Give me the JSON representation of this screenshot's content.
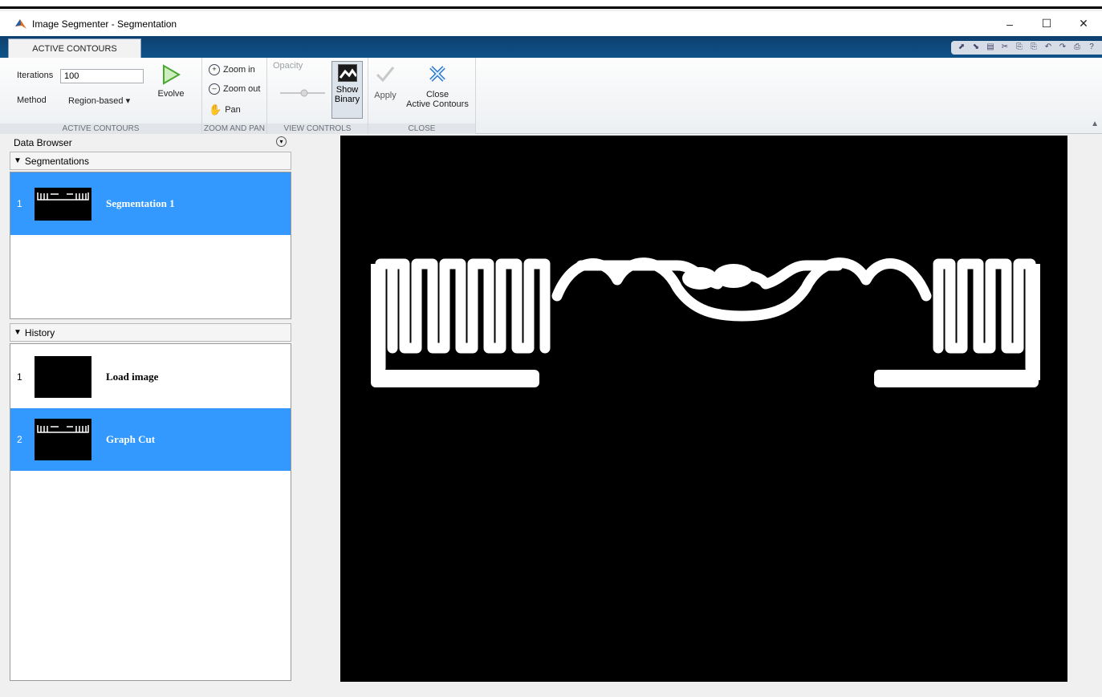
{
  "window": {
    "title": "Image Segmenter - Segmentation",
    "controls": [
      "–",
      "☐",
      "✕"
    ]
  },
  "tab": {
    "label": "ACTIVE CONTOURS"
  },
  "quick_access": [
    "⬈",
    "⬊",
    "▤",
    "✂",
    "⎘",
    "⎘",
    "↶",
    "↷",
    "⎙",
    "?"
  ],
  "ribbon": {
    "active_contours": {
      "iterations_label": "Iterations",
      "iterations_value": "100",
      "method_label": "Method",
      "method_value": "Region-based",
      "evolve_label": "Evolve",
      "section_label": "ACTIVE CONTOURS"
    },
    "zoom_pan": {
      "zoom_in_label": "Zoom in",
      "zoom_out_label": "Zoom out",
      "pan_label": "Pan",
      "section_label": "ZOOM AND PAN"
    },
    "view_controls": {
      "opacity_label": "Opacity",
      "show_binary_line1": "Show",
      "show_binary_line2": "Binary",
      "section_label": "VIEW CONTROLS"
    },
    "close": {
      "apply_label": "Apply",
      "close_line1": "Close",
      "close_line2": "Active Contours",
      "section_label": "CLOSE"
    }
  },
  "data_browser": {
    "title": "Data Browser",
    "segmentations": {
      "header": "Segmentations",
      "items": [
        {
          "num": "1",
          "label": "Segmentation 1"
        }
      ]
    },
    "history": {
      "header": "History",
      "items": [
        {
          "num": "1",
          "label": "Load image"
        },
        {
          "num": "2",
          "label": "Graph Cut"
        }
      ]
    }
  },
  "colors": {
    "selection": "#3399ff",
    "tabbar": "#0f5389",
    "canvas_bg": "#000000",
    "mask": "#ffffff"
  }
}
